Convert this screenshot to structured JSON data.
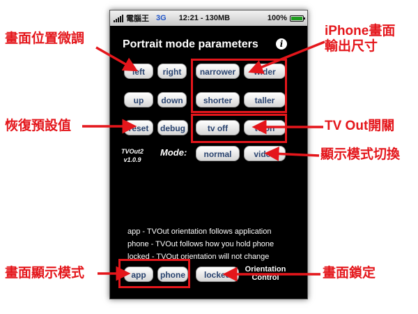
{
  "status_bar": {
    "carrier": "電腦王",
    "network": "3G",
    "time": "12:21 - 130MB",
    "battery": "100%"
  },
  "screen": {
    "title": "Portrait mode parameters",
    "info_glyph": "i",
    "buttons": {
      "left": "left",
      "right": "right",
      "up": "up",
      "down": "down",
      "narrower": "narrower",
      "wider": "wider",
      "shorter": "shorter",
      "taller": "taller",
      "reset": "reset",
      "debug": "debug",
      "tv_off": "tv off",
      "tv_on": "tv on",
      "normal": "normal",
      "video": "video",
      "app": "app",
      "phone": "phone",
      "locked": "locked"
    },
    "version_line1": "TVOut2",
    "version_line2": "v1.0.9",
    "mode_label": "Mode:",
    "help_lines": [
      "app - TVOut orientation follows application",
      "phone - TVOut follows how you hold phone",
      "locked - TVOut orientation will not change"
    ],
    "orientation_line1": "Orientation",
    "orientation_line2": "Control"
  },
  "annotations": {
    "position_adjust": "畫面位置微調",
    "iphone_output_line1": "iPhone畫面",
    "iphone_output_line2": "輸出尺寸",
    "restore_default": "恢復預設值",
    "tv_out_switch": "TV Out開關",
    "display_mode_switch": "顯示模式切換",
    "screen_display_mode": "畫面顯示模式",
    "screen_lock": "畫面鎖定"
  },
  "colors": {
    "annotation_red": "#e4161b",
    "button_text": "#2a4470",
    "network_blue": "#1f54c9"
  }
}
